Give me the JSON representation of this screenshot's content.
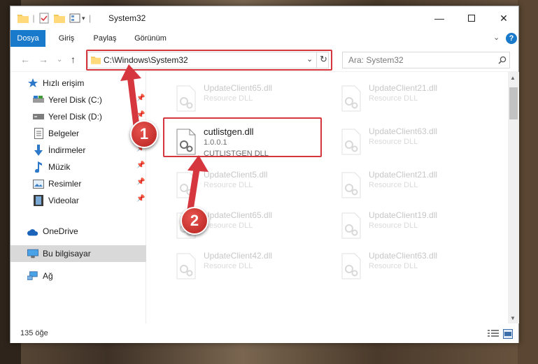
{
  "window": {
    "title": "System32",
    "controls": [
      "minimize-icon",
      "maximize-icon",
      "close-icon"
    ]
  },
  "ribbon": {
    "tabs": [
      {
        "label": "Dosya",
        "active": true
      },
      {
        "label": "Giriş",
        "active": false
      },
      {
        "label": "Paylaş",
        "active": false
      },
      {
        "label": "Görünüm",
        "active": false
      }
    ],
    "help": "?"
  },
  "address": {
    "path": "C:\\Windows\\System32",
    "search_placeholder": "Ara: System32"
  },
  "sidebar": {
    "items": [
      {
        "label": "Hızlı erişim",
        "icon": "star-icon",
        "pinned": false
      },
      {
        "label": "Yerel Disk (C:)",
        "icon": "drive-icon",
        "pinned": true
      },
      {
        "label": "Yerel Disk (D:)",
        "icon": "drive-icon",
        "pinned": true
      },
      {
        "label": "Belgeler",
        "icon": "documents-icon",
        "pinned": true
      },
      {
        "label": "İndirmeler",
        "icon": "download-icon",
        "pinned": true
      },
      {
        "label": "Müzik",
        "icon": "music-icon",
        "pinned": true
      },
      {
        "label": "Resimler",
        "icon": "pictures-icon",
        "pinned": true
      },
      {
        "label": "Videolar",
        "icon": "video-icon",
        "pinned": true
      },
      {
        "label": "OneDrive",
        "icon": "cloud-icon",
        "pinned": false
      },
      {
        "label": "Bu bilgisayar",
        "icon": "computer-icon",
        "pinned": false,
        "selected": true
      },
      {
        "label": "Ağ",
        "icon": "network-icon",
        "pinned": false
      }
    ]
  },
  "files": [
    {
      "name": "UpdateClient65.dll",
      "desc": "Resource DLL",
      "ghost": true
    },
    {
      "name": "UpdateClient21.dll",
      "desc": "Resource DLL",
      "ghost": true
    },
    {
      "name": "cutlistgen.dll",
      "version": "1.0.0.1",
      "desc": "CUTLISTGEN DLL",
      "ghost": false
    },
    {
      "name": "UpdateClient63.dll",
      "desc": "Resource DLL",
      "ghost": true
    },
    {
      "name": "UpdateClient5.dll",
      "desc": "Resource DLL",
      "ghost": true
    },
    {
      "name": "UpdateClient21.dll",
      "desc": "Resource DLL",
      "ghost": true
    },
    {
      "name": "UpdateClient65.dll",
      "desc": "Resource DLL",
      "ghost": true
    },
    {
      "name": "UpdateClient19.dll",
      "desc": "Resource DLL",
      "ghost": true
    },
    {
      "name": "UpdateClient42.dll",
      "desc": "Resource DLL",
      "ghost": true
    },
    {
      "name": "UpdateClient63.dll",
      "desc": "Resource DLL",
      "ghost": true
    }
  ],
  "status": {
    "item_count": "135 öğe"
  },
  "annotations": {
    "marker1": "1",
    "marker2": "2"
  },
  "colors": {
    "accent": "#1979ca",
    "highlight": "#d6373e",
    "selected_nav": "#d9d9d9"
  }
}
